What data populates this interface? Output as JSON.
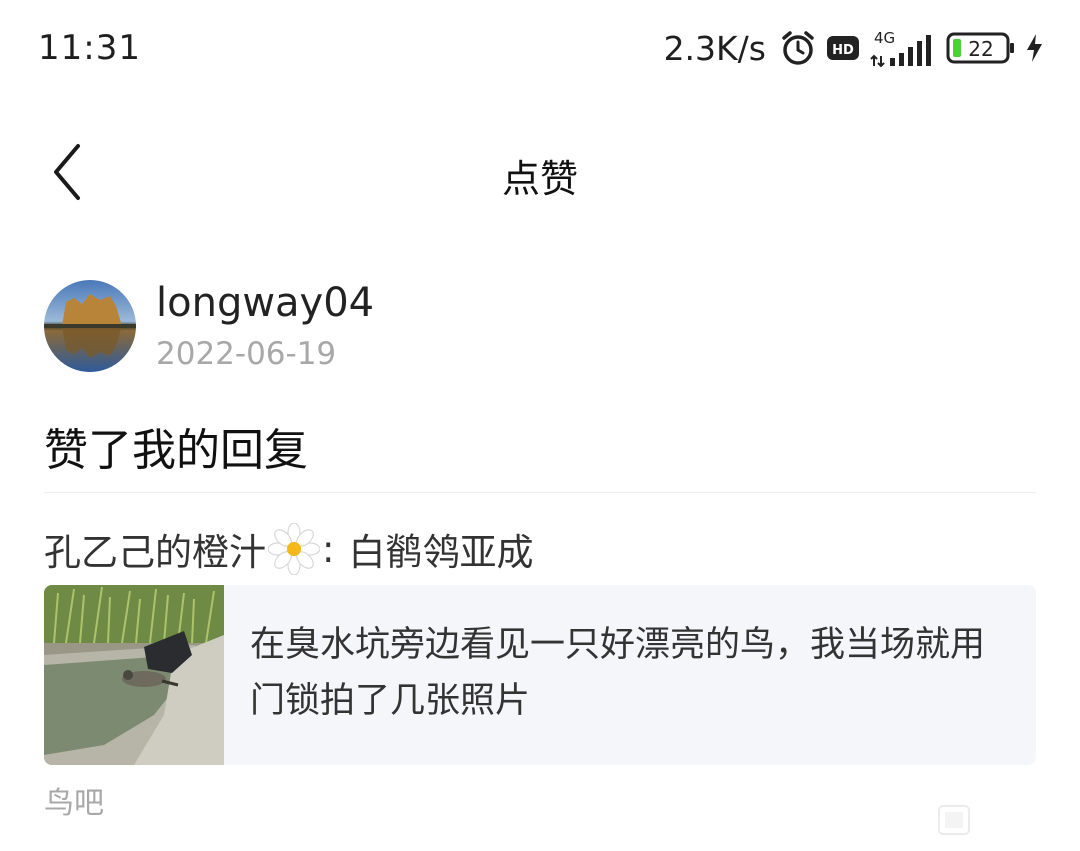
{
  "status_bar": {
    "time": "11:31",
    "net_speed": "2.3K/s",
    "network": "4G",
    "hd_badge": "HD",
    "battery": "22",
    "icons": [
      "alarm-icon",
      "hd-icon",
      "signal-icon",
      "battery-icon",
      "charge-icon"
    ],
    "battery_color": "#4cd137"
  },
  "nav": {
    "title": "点赞",
    "back_icon": "chevron-left-icon"
  },
  "like_item": {
    "username": "longway04",
    "date": "2022-06-19",
    "action": "赞了我的回复",
    "reply_author": "孔乙己的橙汁",
    "reply_separator": ":",
    "reply_content": "白鹡鸰亚成",
    "post": {
      "text": "在臭水坑旁边看见一只好漂亮的鸟，我当场就用门锁拍了几张照片"
    },
    "forum": "鸟吧"
  }
}
